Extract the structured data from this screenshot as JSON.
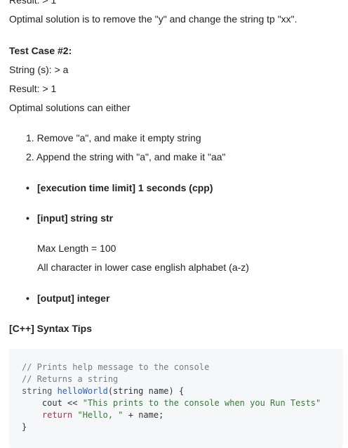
{
  "top_clipped": "Result: > 1",
  "optimal_1": "Optimal solution is to remove the \"y\" and change the string tp \"xx\".",
  "test_case_2": {
    "heading": "Test Case #2:",
    "string_line": "String (s): > a",
    "result_line": "Result: > 1",
    "optimal_line": "Optimal solutions can either",
    "options": [
      {
        "num": "1.",
        "text": "Remove \"a\", and make it empty string"
      },
      {
        "num": "2.",
        "text": "Append the string with \"a\", and make it \"aa\""
      }
    ]
  },
  "constraints": {
    "time_limit": "[execution time limit] 1 seconds (cpp)",
    "input": "[input] string str",
    "input_details": [
      "Max Length = 100",
      "All character in lower case english alphabet (a-z)"
    ],
    "output": "[output] integer"
  },
  "syntax_tips": {
    "heading": "[C++] Syntax Tips",
    "code": {
      "comment1": "// Prints help message to the console",
      "comment2": "// Returns a string",
      "sig_type": "string ",
      "sig_fn": "helloWorld",
      "sig_rest": "(string name) {",
      "line4_pre": "    cout << ",
      "line4_str": "\"This prints to the console when you Run Tests\"",
      "line5_kw": "    return ",
      "line5_str": "\"Hello, \"",
      "line5_rest": " + name;",
      "close": "}"
    }
  }
}
